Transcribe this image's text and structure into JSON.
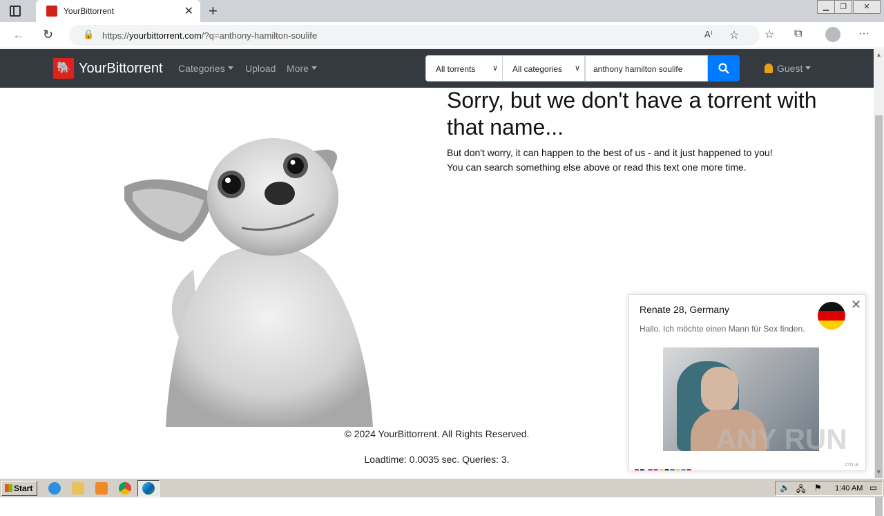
{
  "browser": {
    "tab_title": "YourBittorrent",
    "url_prefix": "https://",
    "url_domain": "yourbittorrent.com",
    "url_rest": "/?q=anthony-hamilton-soulife"
  },
  "nav": {
    "brand": "YourBittorrent",
    "categories": "Categories",
    "upload": "Upload",
    "more": "More",
    "filter_torrents": "All torrents",
    "filter_categories": "All categories",
    "search_value": "anthony hamilton soulife",
    "guest": "Guest"
  },
  "main": {
    "headline": "Sorry, but we don't have a torrent with that name...",
    "line1": "But don't worry, it can happen to the best of us - and it just happened to you!",
    "line2": "You can search something else above or read this text one more time.",
    "copyright": "© 2024 YourBittorrent. All Rights Reserved.",
    "loadtime": "Loadtime: 0.0035 sec. Queries: 3."
  },
  "popup": {
    "name": "Renate 28, Germany",
    "message": "Hallo. Ich möchte einen Mann für Sex finden.",
    "cm": "cm.a"
  },
  "watermark": "ANY RUN",
  "taskbar": {
    "start": "Start",
    "clock": "1:40 AM"
  },
  "colors": {
    "navbar": "#343a40",
    "search_button": "#007bff",
    "brand_red": "#e0221d"
  }
}
